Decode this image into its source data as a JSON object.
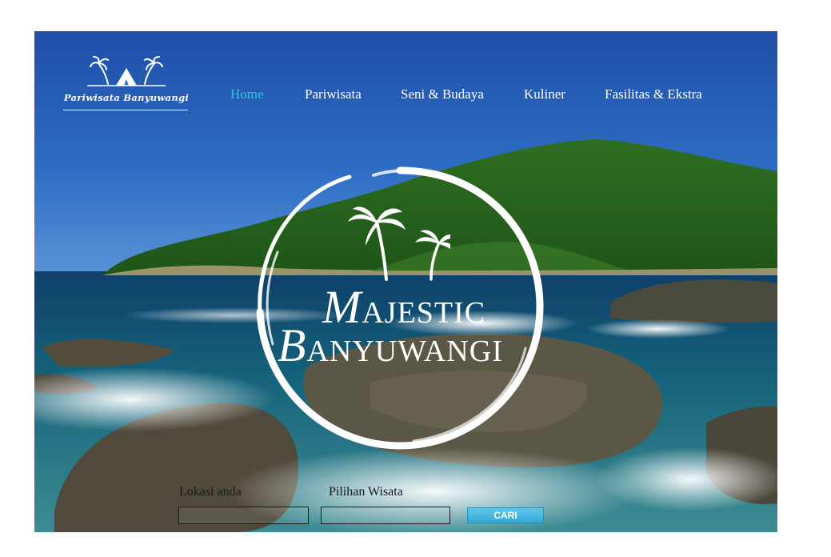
{
  "brand": {
    "logo_text": "Pariwisata Banyuwangi"
  },
  "nav": {
    "items": [
      {
        "label": "Home",
        "active": true
      },
      {
        "label": "Pariwisata",
        "active": false
      },
      {
        "label": "Seni & Budaya",
        "active": false
      },
      {
        "label": "Kuliner",
        "active": false
      },
      {
        "label": "Fasilitas & Ekstra",
        "active": false
      }
    ]
  },
  "hero": {
    "title_line1_initial": "M",
    "title_line1_rest": "AJESTIC",
    "title_line2_initial": "B",
    "title_line2_rest": "ANYUWANGI"
  },
  "search": {
    "location_label": "Lokasi anda",
    "location_value": "",
    "choice_label": "Pilihan Wisata",
    "choice_value": "",
    "button_label": "CARI"
  },
  "colors": {
    "active_nav": "#2fc4d8",
    "button": "#40b4e0"
  }
}
